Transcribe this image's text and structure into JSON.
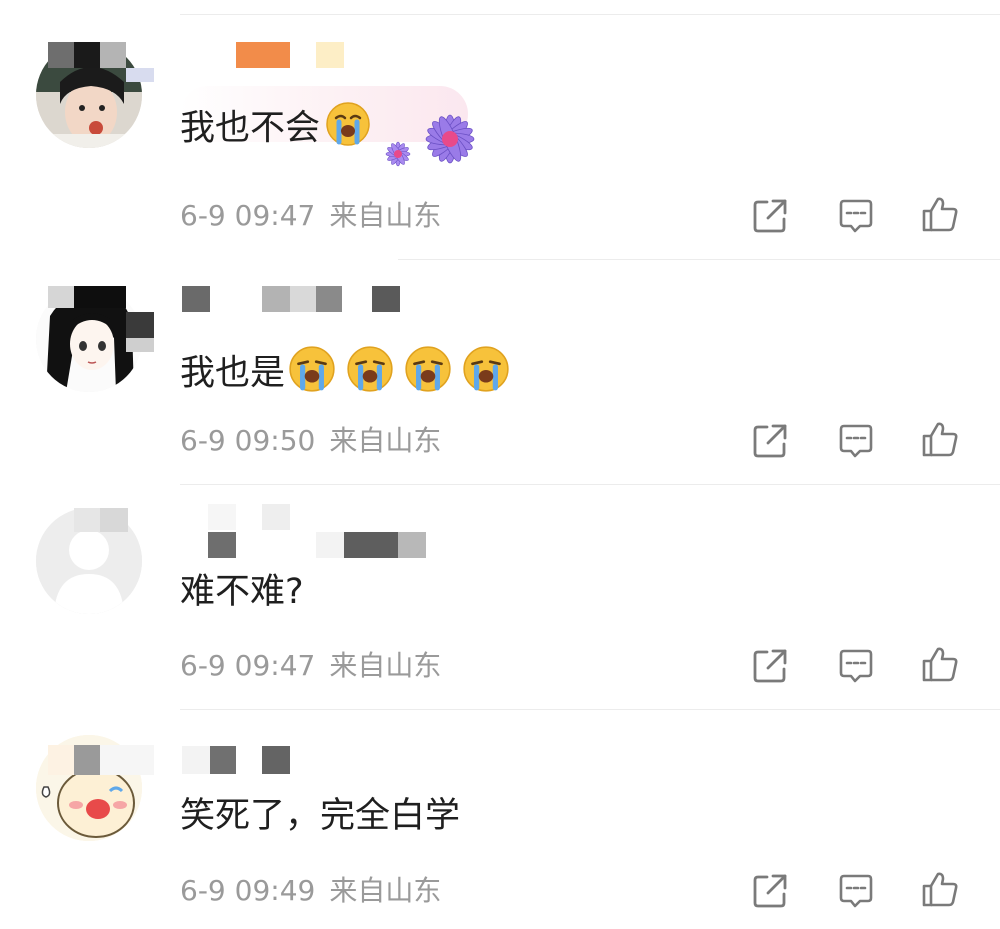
{
  "comments": [
    {
      "text": "我也不会",
      "emojis": [
        "loudly-crying-face"
      ],
      "decoration": "purple-flower-sticker",
      "date": "6-9 09:47",
      "location": "来自山东"
    },
    {
      "text": "我也是",
      "emojis": [
        "loudly-crying-face",
        "loudly-crying-face",
        "loudly-crying-face",
        "loudly-crying-face"
      ],
      "date": "6-9 09:50",
      "location": "来自山东"
    },
    {
      "text": "难不难?",
      "emojis": [],
      "date": "6-9 09:47",
      "location": "来自山东"
    },
    {
      "text": "笑死了，完全白学",
      "emojis": [],
      "date": "6-9 09:49",
      "location": "来自山东"
    }
  ],
  "actions": {
    "share_icon": "share-icon",
    "reply_icon": "comment-icon",
    "like_icon": "thumbs-up-icon"
  },
  "colors": {
    "text": "#1f1f1f",
    "meta": "#9a9a9a",
    "icon": "#7a7a7a",
    "divider": "#ececec"
  }
}
